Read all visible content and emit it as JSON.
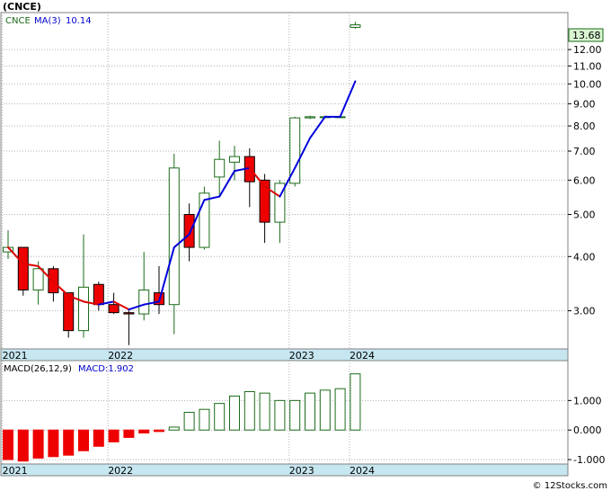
{
  "title": "(CNCE)",
  "watermark": "© 12Stocks.com",
  "colors": {
    "up": "#1a6b1a",
    "down": "#ee0000",
    "ma_up": "#0000dd",
    "ma_down": "#dd0000",
    "axis_band": "#c6e6f0",
    "price_label_bg": "#d8f5d0",
    "macd_bar": "#1a6b1a",
    "macd_bar_neg_fill": "#ee0000"
  },
  "chart_data": [
    {
      "type": "candlestick",
      "name": "price",
      "legend": {
        "symbol": "CNCE",
        "ma_label": "MA(3)",
        "ma_value": "10.14"
      },
      "scale": "log",
      "ylim": [
        2.45,
        14.6
      ],
      "y_ticks": [
        3.0,
        4.0,
        5.0,
        6.0,
        7.0,
        8.0,
        9.0,
        10.0,
        11.0,
        12.0
      ],
      "y_tick_labels": [
        "3.00",
        "4.00",
        "5.00",
        "6.00",
        "7.00",
        "8.00",
        "9.00",
        "10.00",
        "11.00",
        "12.00"
      ],
      "last_price_label": "13.68",
      "x_labels": [
        {
          "label": "2021",
          "index": 0
        },
        {
          "label": "2022",
          "index": 7
        },
        {
          "label": "2023",
          "index": 19
        },
        {
          "label": "2024",
          "index": 23
        }
      ],
      "candles": [
        {
          "open": 4.1,
          "high": 4.6,
          "low": 3.95,
          "close": 4.2
        },
        {
          "open": 4.2,
          "high": 4.2,
          "low": 3.25,
          "close": 3.35
        },
        {
          "open": 3.35,
          "high": 3.9,
          "low": 3.1,
          "close": 3.75
        },
        {
          "open": 3.75,
          "high": 3.8,
          "low": 3.15,
          "close": 3.3
        },
        {
          "open": 3.3,
          "high": 3.3,
          "low": 2.6,
          "close": 2.7
        },
        {
          "open": 2.7,
          "high": 4.5,
          "low": 2.6,
          "close": 3.4
        },
        {
          "open": 3.45,
          "high": 3.5,
          "low": 3.0,
          "close": 3.1
        },
        {
          "open": 3.1,
          "high": 3.3,
          "low": 2.95,
          "close": 2.97
        },
        {
          "open": 2.97,
          "high": 3.0,
          "low": 2.5,
          "close": 2.95
        },
        {
          "open": 2.95,
          "high": 4.1,
          "low": 2.85,
          "close": 3.35
        },
        {
          "open": 3.3,
          "high": 3.8,
          "low": 2.95,
          "close": 3.1
        },
        {
          "open": 3.1,
          "high": 6.9,
          "low": 2.65,
          "close": 6.4
        },
        {
          "open": 5.0,
          "high": 5.3,
          "low": 3.9,
          "close": 4.2
        },
        {
          "open": 4.2,
          "high": 5.8,
          "low": 4.15,
          "close": 5.6
        },
        {
          "open": 6.1,
          "high": 7.4,
          "low": 5.5,
          "close": 6.7
        },
        {
          "open": 6.6,
          "high": 7.2,
          "low": 6.0,
          "close": 6.8
        },
        {
          "open": 6.8,
          "high": 7.1,
          "low": 5.2,
          "close": 5.95
        },
        {
          "open": 6.0,
          "high": 6.2,
          "low": 4.3,
          "close": 4.8
        },
        {
          "open": 4.8,
          "high": 6.0,
          "low": 4.3,
          "close": 5.9
        },
        {
          "open": 5.9,
          "high": 8.4,
          "low": 5.8,
          "close": 8.35
        },
        {
          "open": 8.35,
          "high": 8.45,
          "low": 8.3,
          "close": 8.4
        },
        {
          "open": 8.4,
          "high": 8.45,
          "low": 8.35,
          "close": 8.4
        },
        {
          "open": 8.4,
          "high": 8.45,
          "low": 8.35,
          "close": 8.4
        },
        {
          "open": 13.5,
          "high": 13.9,
          "low": 13.4,
          "close": 13.68
        }
      ],
      "ma": [
        {
          "index": 0,
          "value": 4.2
        },
        {
          "index": 1,
          "value": 3.85
        },
        {
          "index": 2,
          "value": 3.8
        },
        {
          "index": 3,
          "value": 3.5
        },
        {
          "index": 4,
          "value": 3.25
        },
        {
          "index": 5,
          "value": 3.15
        },
        {
          "index": 6,
          "value": 3.1
        },
        {
          "index": 7,
          "value": 3.15
        },
        {
          "index": 8,
          "value": 3.02
        },
        {
          "index": 9,
          "value": 3.1
        },
        {
          "index": 10,
          "value": 3.15
        },
        {
          "index": 11,
          "value": 4.2
        },
        {
          "index": 12,
          "value": 4.5
        },
        {
          "index": 13,
          "value": 5.4
        },
        {
          "index": 14,
          "value": 5.5
        },
        {
          "index": 15,
          "value": 6.3
        },
        {
          "index": 16,
          "value": 6.4
        },
        {
          "index": 17,
          "value": 5.8
        },
        {
          "index": 18,
          "value": 5.5
        },
        {
          "index": 19,
          "value": 6.4
        },
        {
          "index": 20,
          "value": 7.5
        },
        {
          "index": 21,
          "value": 8.4
        },
        {
          "index": 22,
          "value": 8.4
        },
        {
          "index": 23,
          "value": 10.14
        }
      ]
    },
    {
      "type": "bar",
      "name": "macd",
      "legend": {
        "label": "MACD(26,12,9)",
        "value_label": "MACD:1.902"
      },
      "ylim": [
        -1.15,
        2.35
      ],
      "y_ticks": [
        1.0,
        0.0,
        -1.0
      ],
      "y_tick_labels": [
        "1.000",
        "0.000",
        "-1.000"
      ],
      "x_labels": [
        {
          "label": "2021",
          "index": 0
        },
        {
          "label": "2022",
          "index": 7
        },
        {
          "label": "2023",
          "index": 19
        },
        {
          "label": "2024",
          "index": 23
        }
      ],
      "values": [
        -1.0,
        -1.05,
        -0.95,
        -0.9,
        -0.85,
        -0.7,
        -0.55,
        -0.4,
        -0.25,
        -0.1,
        -0.05,
        0.1,
        0.6,
        0.7,
        0.9,
        1.15,
        1.3,
        1.25,
        1.0,
        1.0,
        1.25,
        1.35,
        1.4,
        1.902
      ]
    }
  ]
}
